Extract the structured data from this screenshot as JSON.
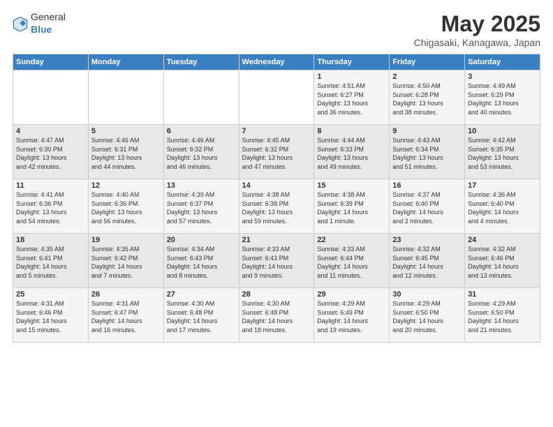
{
  "header": {
    "logo_general": "General",
    "logo_blue": "Blue",
    "month": "May 2025",
    "location": "Chigasaki, Kanagawa, Japan"
  },
  "days_of_week": [
    "Sunday",
    "Monday",
    "Tuesday",
    "Wednesday",
    "Thursday",
    "Friday",
    "Saturday"
  ],
  "weeks": [
    [
      {
        "day": "",
        "info": ""
      },
      {
        "day": "",
        "info": ""
      },
      {
        "day": "",
        "info": ""
      },
      {
        "day": "",
        "info": ""
      },
      {
        "day": "1",
        "info": "Sunrise: 4:51 AM\nSunset: 6:27 PM\nDaylight: 13 hours\nand 36 minutes."
      },
      {
        "day": "2",
        "info": "Sunrise: 4:50 AM\nSunset: 6:28 PM\nDaylight: 13 hours\nand 38 minutes."
      },
      {
        "day": "3",
        "info": "Sunrise: 4:49 AM\nSunset: 6:29 PM\nDaylight: 13 hours\nand 40 minutes."
      }
    ],
    [
      {
        "day": "4",
        "info": "Sunrise: 4:47 AM\nSunset: 6:30 PM\nDaylight: 13 hours\nand 42 minutes."
      },
      {
        "day": "5",
        "info": "Sunrise: 4:46 AM\nSunset: 6:31 PM\nDaylight: 13 hours\nand 44 minutes."
      },
      {
        "day": "6",
        "info": "Sunrise: 4:46 AM\nSunset: 6:32 PM\nDaylight: 13 hours\nand 46 minutes."
      },
      {
        "day": "7",
        "info": "Sunrise: 4:45 AM\nSunset: 6:32 PM\nDaylight: 13 hours\nand 47 minutes."
      },
      {
        "day": "8",
        "info": "Sunrise: 4:44 AM\nSunset: 6:33 PM\nDaylight: 13 hours\nand 49 minutes."
      },
      {
        "day": "9",
        "info": "Sunrise: 4:43 AM\nSunset: 6:34 PM\nDaylight: 13 hours\nand 51 minutes."
      },
      {
        "day": "10",
        "info": "Sunrise: 4:42 AM\nSunset: 6:35 PM\nDaylight: 13 hours\nand 53 minutes."
      }
    ],
    [
      {
        "day": "11",
        "info": "Sunrise: 4:41 AM\nSunset: 6:36 PM\nDaylight: 13 hours\nand 54 minutes."
      },
      {
        "day": "12",
        "info": "Sunrise: 4:40 AM\nSunset: 6:36 PM\nDaylight: 13 hours\nand 56 minutes."
      },
      {
        "day": "13",
        "info": "Sunrise: 4:39 AM\nSunset: 6:37 PM\nDaylight: 13 hours\nand 57 minutes."
      },
      {
        "day": "14",
        "info": "Sunrise: 4:38 AM\nSunset: 6:38 PM\nDaylight: 13 hours\nand 59 minutes."
      },
      {
        "day": "15",
        "info": "Sunrise: 4:38 AM\nSunset: 6:39 PM\nDaylight: 14 hours\nand 1 minute."
      },
      {
        "day": "16",
        "info": "Sunrise: 4:37 AM\nSunset: 6:40 PM\nDaylight: 14 hours\nand 2 minutes."
      },
      {
        "day": "17",
        "info": "Sunrise: 4:36 AM\nSunset: 6:40 PM\nDaylight: 14 hours\nand 4 minutes."
      }
    ],
    [
      {
        "day": "18",
        "info": "Sunrise: 4:35 AM\nSunset: 6:41 PM\nDaylight: 14 hours\nand 5 minutes."
      },
      {
        "day": "19",
        "info": "Sunrise: 4:35 AM\nSunset: 6:42 PM\nDaylight: 14 hours\nand 7 minutes."
      },
      {
        "day": "20",
        "info": "Sunrise: 4:34 AM\nSunset: 6:43 PM\nDaylight: 14 hours\nand 8 minutes."
      },
      {
        "day": "21",
        "info": "Sunrise: 4:33 AM\nSunset: 6:43 PM\nDaylight: 14 hours\nand 9 minutes."
      },
      {
        "day": "22",
        "info": "Sunrise: 4:33 AM\nSunset: 6:44 PM\nDaylight: 14 hours\nand 11 minutes."
      },
      {
        "day": "23",
        "info": "Sunrise: 4:32 AM\nSunset: 6:45 PM\nDaylight: 14 hours\nand 12 minutes."
      },
      {
        "day": "24",
        "info": "Sunrise: 4:32 AM\nSunset: 6:46 PM\nDaylight: 14 hours\nand 13 minutes."
      }
    ],
    [
      {
        "day": "25",
        "info": "Sunrise: 4:31 AM\nSunset: 6:46 PM\nDaylight: 14 hours\nand 15 minutes."
      },
      {
        "day": "26",
        "info": "Sunrise: 4:31 AM\nSunset: 6:47 PM\nDaylight: 14 hours\nand 16 minutes."
      },
      {
        "day": "27",
        "info": "Sunrise: 4:30 AM\nSunset: 6:48 PM\nDaylight: 14 hours\nand 17 minutes."
      },
      {
        "day": "28",
        "info": "Sunrise: 4:30 AM\nSunset: 6:48 PM\nDaylight: 14 hours\nand 18 minutes."
      },
      {
        "day": "29",
        "info": "Sunrise: 4:29 AM\nSunset: 6:49 PM\nDaylight: 14 hours\nand 19 minutes."
      },
      {
        "day": "30",
        "info": "Sunrise: 4:29 AM\nSunset: 6:50 PM\nDaylight: 14 hours\nand 20 minutes."
      },
      {
        "day": "31",
        "info": "Sunrise: 4:29 AM\nSunset: 6:50 PM\nDaylight: 14 hours\nand 21 minutes."
      }
    ]
  ]
}
